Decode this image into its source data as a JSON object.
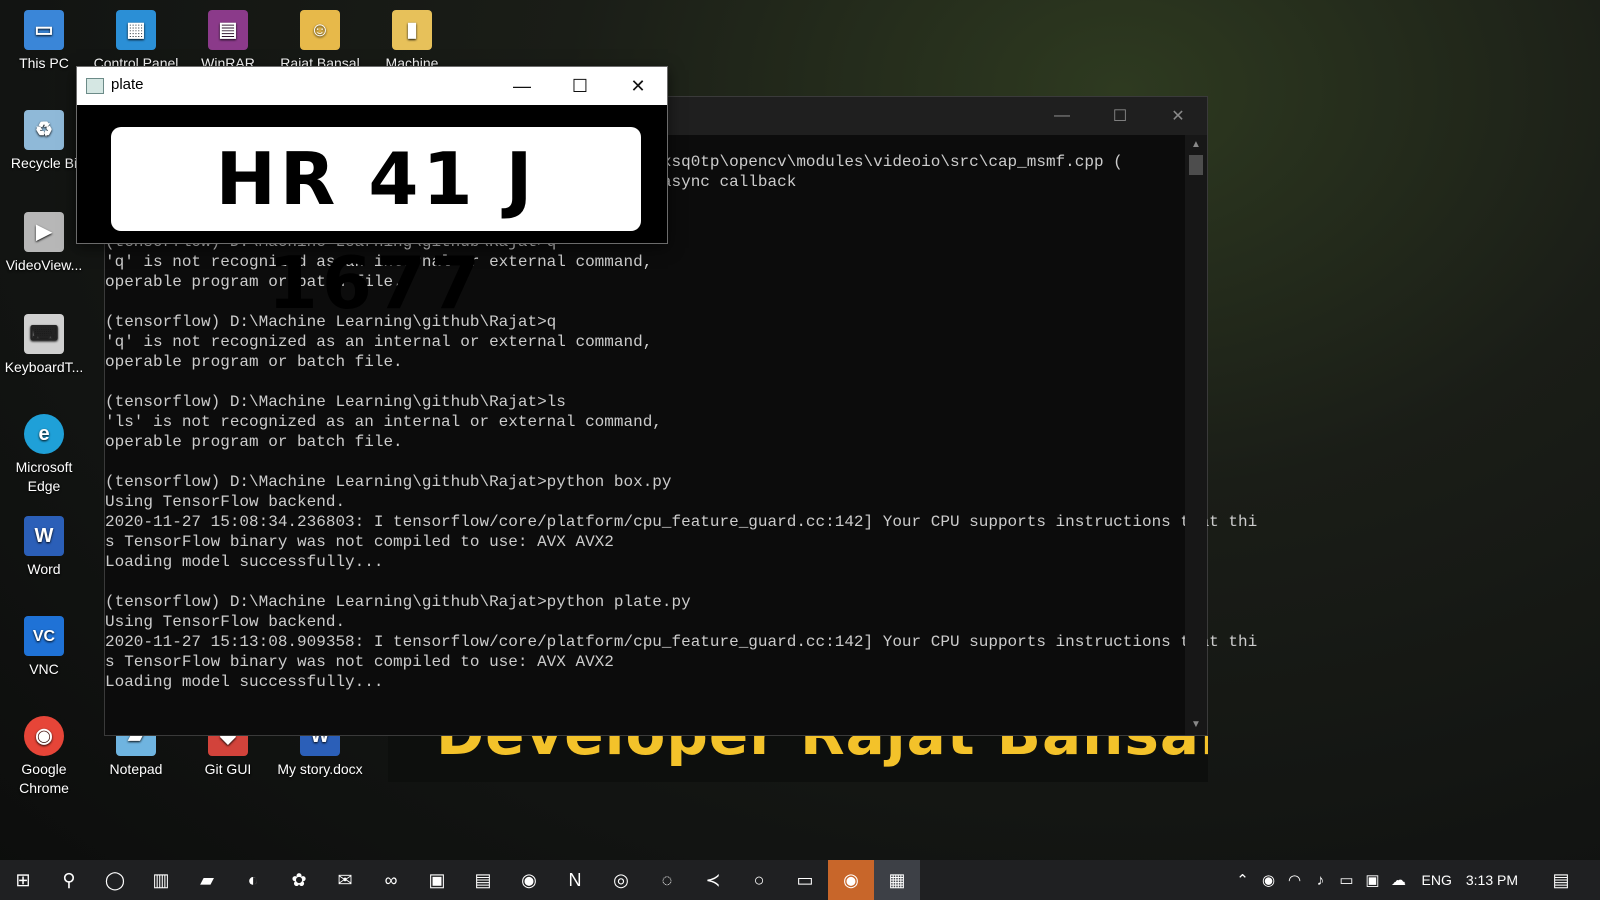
{
  "desktop_icons": [
    {
      "label": "This PC",
      "icon": "this-pc-icon",
      "color": "#3a86d8"
    },
    {
      "label": "Control Panel",
      "icon": "control-panel-icon",
      "color": "#2b8fd6"
    },
    {
      "label": "WinRAR",
      "icon": "winrar-icon",
      "color": "#8b3a8a"
    },
    {
      "label": "Rajat Bansal",
      "icon": "user-folder-icon",
      "color": "#e7b94a"
    },
    {
      "label": "Machine",
      "icon": "folder-icon",
      "color": "#e7c15a"
    },
    {
      "label": "Recycle Bi",
      "icon": "recycle-bin-icon",
      "color": "#8fb9d8"
    },
    {
      "label": "VideoView...",
      "icon": "video-viewer-icon",
      "color": "#b7b7b7"
    },
    {
      "label": "KeyboardT...",
      "icon": "keyboard-icon",
      "color": "#d0d0d0"
    },
    {
      "label": "Microsoft Edge",
      "icon": "edge-icon",
      "color": "#1fa0d8"
    },
    {
      "label": "Word",
      "icon": "word-icon",
      "color": "#2b5fb8"
    },
    {
      "label": "VNC",
      "icon": "vnc-icon",
      "color": "#1f72d6"
    },
    {
      "label": "Google Chrome",
      "icon": "chrome-icon",
      "color": "#e64538"
    },
    {
      "label": "Notepad",
      "icon": "notepad-icon",
      "color": "#6fb4e0"
    },
    {
      "label": "Git GUI",
      "icon": "git-gui-icon",
      "color": "#d2433b"
    },
    {
      "label": "My story.docx",
      "icon": "docx-icon",
      "color": "#2b5fb8"
    }
  ],
  "banner_text": "Developer Rajat Bansal",
  "plate_window": {
    "title": "plate",
    "plate_text": "HR 41 J 1677"
  },
  "console": {
    "lines": [
      "                                                q-build-6sxsq0tp\\opencv\\modules\\videoio\\src\\cap_msmf.cpp (",
      "                                                rminating async callback",
      "",
      "",
      "(tensorflow) D:\\Machine Learning\\github\\Rajat>q",
      "'q' is not recognized as an internal or external command,",
      "operable program or batch file.",
      "",
      "(tensorflow) D:\\Machine Learning\\github\\Rajat>q",
      "'q' is not recognized as an internal or external command,",
      "operable program or batch file.",
      "",
      "(tensorflow) D:\\Machine Learning\\github\\Rajat>ls",
      "'ls' is not recognized as an internal or external command,",
      "operable program or batch file.",
      "",
      "(tensorflow) D:\\Machine Learning\\github\\Rajat>python box.py",
      "Using TensorFlow backend.",
      "2020-11-27 15:08:34.236803: I tensorflow/core/platform/cpu_feature_guard.cc:142] Your CPU supports instructions that thi",
      "s TensorFlow binary was not compiled to use: AVX AVX2",
      "Loading model successfully...",
      "",
      "(tensorflow) D:\\Machine Learning\\github\\Rajat>python plate.py",
      "Using TensorFlow backend.",
      "2020-11-27 15:13:08.909358: I tensorflow/core/platform/cpu_feature_guard.cc:142] Your CPU supports instructions that thi",
      "s TensorFlow binary was not compiled to use: AVX AVX2",
      "Loading model successfully..."
    ]
  },
  "taskbar": {
    "items": [
      {
        "icon": "start-icon",
        "glyph": "⊞"
      },
      {
        "icon": "search-icon",
        "glyph": "⚲"
      },
      {
        "icon": "cortana-icon",
        "glyph": "◯"
      },
      {
        "icon": "task-view-icon",
        "glyph": "▥"
      },
      {
        "icon": "notepad-icon",
        "glyph": "▰"
      },
      {
        "icon": "edge-icon",
        "glyph": "◐"
      },
      {
        "icon": "paint-icon",
        "glyph": "✿"
      },
      {
        "icon": "mail-icon",
        "glyph": "✉"
      },
      {
        "icon": "arduino-icon",
        "glyph": "∞"
      },
      {
        "icon": "store-icon",
        "glyph": "▣"
      },
      {
        "icon": "pc-icon",
        "glyph": "▤"
      },
      {
        "icon": "chrome-icon",
        "glyph": "◉"
      },
      {
        "icon": "onenote-icon",
        "glyph": "N"
      },
      {
        "icon": "obs-icon",
        "glyph": "◎"
      },
      {
        "icon": "loader-icon",
        "glyph": "◌"
      },
      {
        "icon": "vscode-icon",
        "glyph": "≺"
      },
      {
        "icon": "circle-app-icon",
        "glyph": "○"
      },
      {
        "icon": "console-icon",
        "glyph": "▭"
      },
      {
        "icon": "recorder-icon",
        "glyph": "◉"
      },
      {
        "icon": "plate-window-icon",
        "glyph": "▦"
      }
    ],
    "language": "ENG",
    "time": "3:13 PM"
  }
}
